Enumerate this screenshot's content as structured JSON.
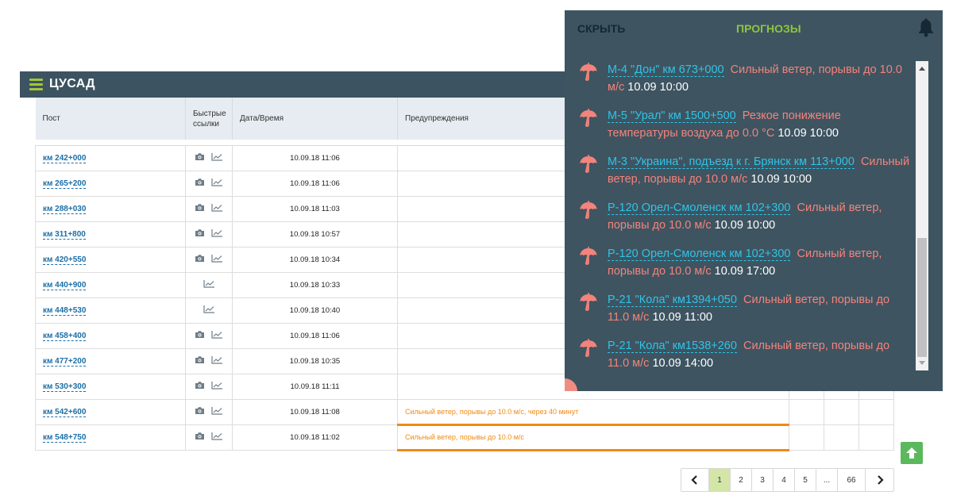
{
  "panel": {
    "title": "ЦУСАД"
  },
  "table": {
    "headers": {
      "post": "Пост",
      "links": "Быстрые ссылки",
      "datetime": "Дата/Время",
      "warnings": "Предупреждения"
    },
    "rows": [
      {
        "post": "км 242+000",
        "camera": true,
        "datetime": "10.09.18 11:06",
        "warning": ""
      },
      {
        "post": "км 265+200",
        "camera": true,
        "datetime": "10.09.18 11:06",
        "warning": ""
      },
      {
        "post": "км 288+030",
        "camera": true,
        "datetime": "10.09.18 11:03",
        "warning": ""
      },
      {
        "post": "км 311+800",
        "camera": true,
        "datetime": "10.09.18 10:57",
        "warning": ""
      },
      {
        "post": "км 420+550",
        "camera": true,
        "datetime": "10.09.18 10:34",
        "warning": ""
      },
      {
        "post": "км 440+900",
        "camera": false,
        "datetime": "10.09.18 10:33",
        "warning": ""
      },
      {
        "post": "км 448+530",
        "camera": false,
        "datetime": "10.09.18 10:40",
        "warning": ""
      },
      {
        "post": "км 458+400",
        "camera": true,
        "datetime": "10.09.18 11:06",
        "warning": ""
      },
      {
        "post": "км 477+200",
        "camera": true,
        "datetime": "10.09.18 10:35",
        "warning": ""
      },
      {
        "post": "км 530+300",
        "camera": true,
        "datetime": "10.09.18 11:11",
        "warning": ""
      },
      {
        "post": "км 542+600",
        "camera": true,
        "datetime": "10.09.18 11:08",
        "warning": "Сильный ветер, порывы до 10.0 м/с, через 40 минут"
      },
      {
        "post": "км 548+750",
        "camera": true,
        "datetime": "10.09.18 11:02",
        "warning": "Сильный ветер, порывы до 10.0 м/с"
      }
    ]
  },
  "pagination": {
    "prev_icon": "chevron-left-icon",
    "next_icon": "chevron-right-icon",
    "pages": [
      "1",
      "2",
      "3",
      "4",
      "5",
      "...",
      "66"
    ],
    "current": "1"
  },
  "overlay": {
    "hide_label": "СКРЫТЬ",
    "forecast_label": "ПРОГНОЗЫ",
    "bell_icon": "bell-icon",
    "alerts": [
      {
        "road": "М-4 \"Дон\" км 673+000",
        "text": "Сильный ветер, порывы до 10.0 м/с",
        "time": "10.09 10:00"
      },
      {
        "road": "М-5 \"Урал\" км 1500+500",
        "text": "Резкое понижение температуры воздуха до 0.0 °С",
        "time": "10.09 10:00"
      },
      {
        "road": "М-3 \"Украина\", подъезд к г. Брянск км 113+000",
        "text": "Сильный ветер, порывы до 10.0 м/с",
        "time": "10.09 10:00"
      },
      {
        "road": "Р-120 Орел-Смоленск км 102+300",
        "text": "Сильный ветер, порывы до 10.0 м/с",
        "time": "10.09 10:00"
      },
      {
        "road": "Р-120 Орел-Смоленск км 102+300",
        "text": "Сильный ветер, порывы до 10.0 м/с",
        "time": "10.09 17:00"
      },
      {
        "road": "Р-21 \"Кола\" км1394+050",
        "text": "Сильный ветер, порывы до 11.0 м/с",
        "time": "10.09 11:00"
      },
      {
        "road": "Р-21 \"Кола\" км1538+260",
        "text": "Сильный ветер, порывы до 11.0 м/с",
        "time": "10.09 14:00"
      }
    ]
  },
  "colors": {
    "header_bg": "#3c5361",
    "accent_green": "#8dc63f",
    "link_blue": "#1b6fa6",
    "warning_orange": "#f08a14",
    "alert_text": "#f4837b",
    "alert_road": "#2ec4e6"
  }
}
